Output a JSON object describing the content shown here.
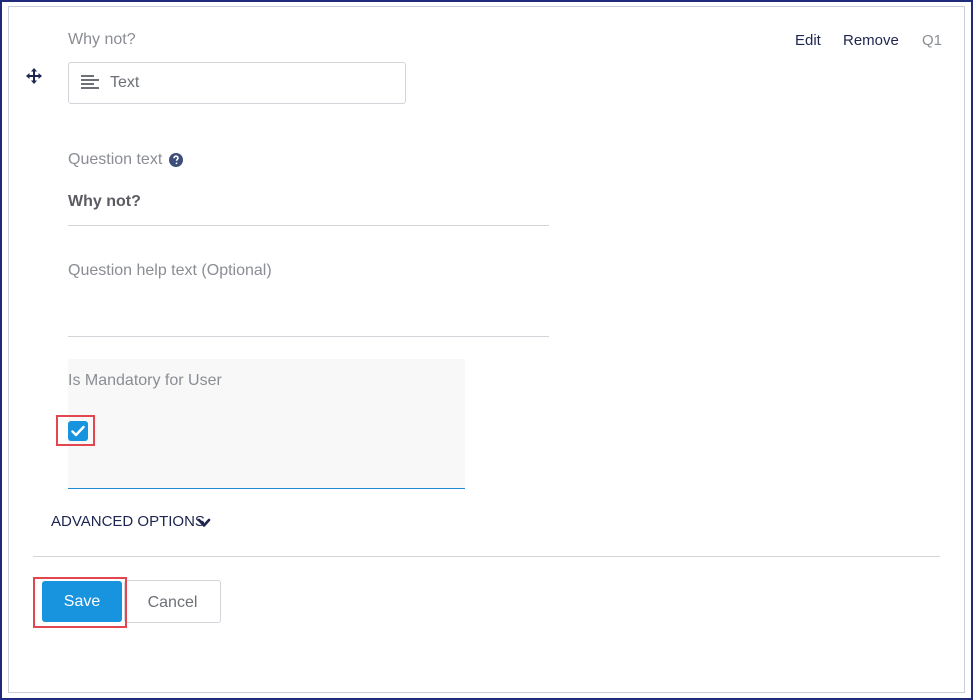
{
  "question": {
    "label": "Why not?",
    "number": "Q1",
    "type_label": "Text",
    "type_icon": "text-lines-icon"
  },
  "actions": {
    "edit_label": "Edit",
    "remove_label": "Remove"
  },
  "question_text": {
    "label": "Question text",
    "value": "Why not?",
    "help_icon": "question-circle-icon"
  },
  "help_text": {
    "placeholder": "Question help text (Optional)"
  },
  "mandatory": {
    "label": "Is Mandatory for User",
    "checked": true
  },
  "advanced": {
    "label": "ADVANCED OPTIONS",
    "icon": "chevron-down-icon"
  },
  "buttons": {
    "save_label": "Save",
    "cancel_label": "Cancel"
  },
  "colors": {
    "accent": "#1893de",
    "highlight": "#e2474f",
    "frame": "#1f2a7a",
    "link": "#1d2550"
  }
}
